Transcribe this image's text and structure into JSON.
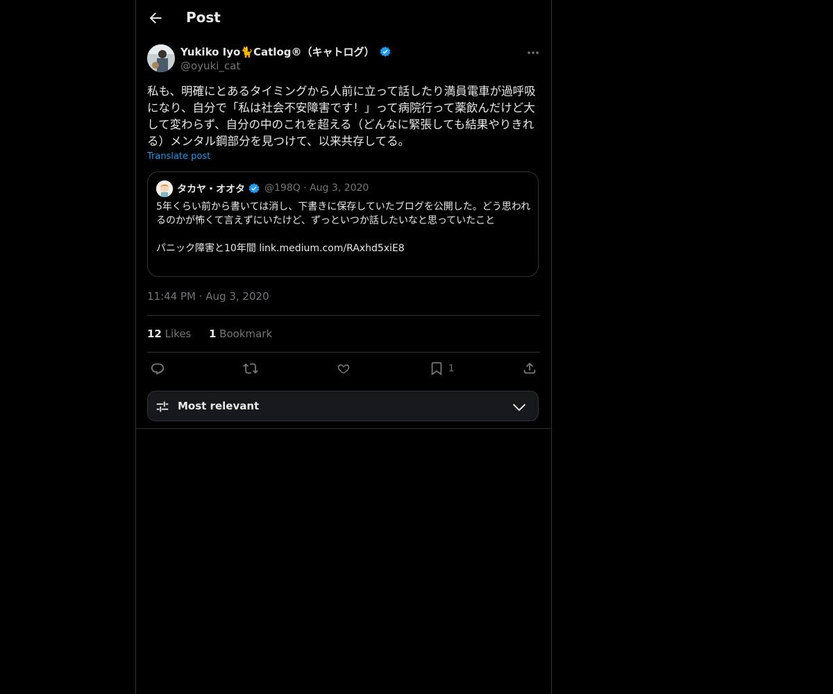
{
  "header": {
    "title": "Post"
  },
  "author": {
    "name": "Yukiko Iyo🐈Catlog®（キャトログ）",
    "handle": "@oyuki_cat"
  },
  "post": {
    "text": "私も、明確にとあるタイミングから人前に立って話したり満員電車が過呼吸になり、自分で「私は社会不安障害です！」って病院行って薬飲んだけど大して変わらず、自分の中のこれを超える（どんなに緊張しても結果やりきれる）メンタル鋼部分を見つけて、以来共存してる。",
    "translate_label": "Translate post",
    "time": "11:44 PM",
    "date": "Aug 3, 2020"
  },
  "quote": {
    "name": "タカヤ・オオタ",
    "handle": "@198Q",
    "date": "Aug 3, 2020",
    "text": "5年くらい前から書いては消し、下書きに保存していたブログを公開した。どう思われるのかが怖くて言えずにいたけど、ずっといつか話したいなと思っていたこと\n\nパニック障害と10年間 link.medium.com/RAxhd5xiE8"
  },
  "stats": {
    "likes_count": "12",
    "likes_label": "Likes",
    "bookmarks_count": "1",
    "bookmarks_label": "Bookmark"
  },
  "actions": {
    "bookmark_count": "1"
  },
  "sort": {
    "label": "Most relevant"
  },
  "colors": {
    "accent": "#1d9bf0",
    "muted": "#71767b",
    "border": "#2f3336",
    "background": "#000000"
  }
}
